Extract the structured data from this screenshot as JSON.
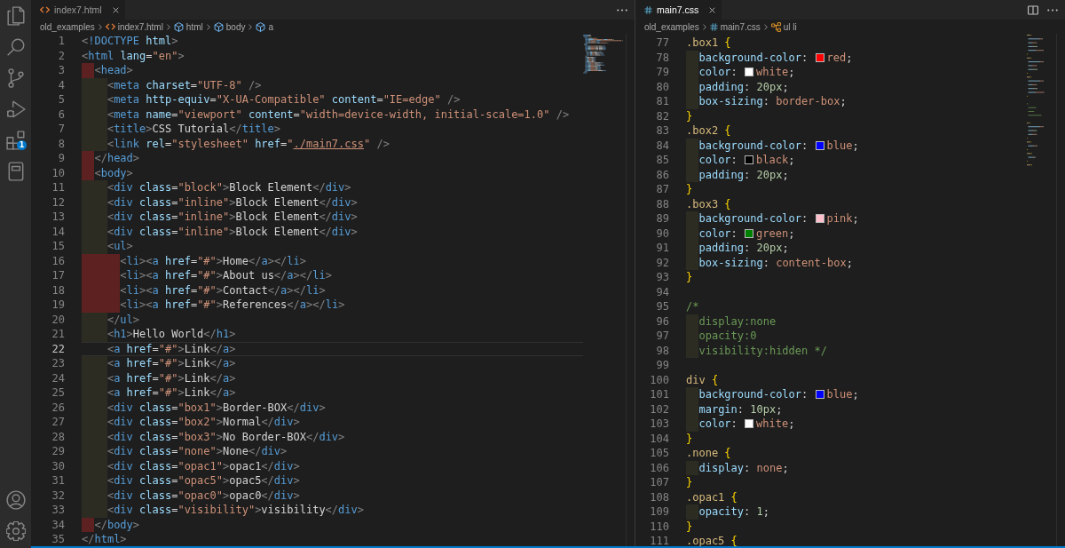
{
  "activity_bar": {
    "top": [
      {
        "kind": "files",
        "selected": false
      },
      {
        "kind": "search",
        "selected": false
      },
      {
        "kind": "branch",
        "selected": false
      },
      {
        "kind": "debug",
        "selected": false
      },
      {
        "kind": "extensions",
        "selected": false,
        "badge": "1"
      },
      {
        "kind": "notebook",
        "selected": false
      }
    ],
    "bottom": [
      {
        "kind": "account",
        "selected": false
      },
      {
        "kind": "gear",
        "selected": false
      }
    ]
  },
  "editor_groups": [
    {
      "focused": false,
      "kind": "html",
      "tabs": [
        {
          "label": "index7.html",
          "kind": "html",
          "selected": true
        }
      ],
      "actions": [
        {
          "kind": "more"
        }
      ],
      "breadcrumbs": [
        {
          "label": "old_examples",
          "kind": "folder"
        },
        {
          "label": "index7.html",
          "kind": "html"
        },
        {
          "label": "html",
          "kind": "element"
        },
        {
          "label": "body",
          "kind": "element"
        },
        {
          "label": "a",
          "kind": "element"
        }
      ],
      "lines": [
        {
          "number": "1",
          "code": "<!DOCTYPE html>",
          "current": false,
          "link": false
        },
        {
          "number": "2",
          "code": "<html lang=\"en\">",
          "current": false,
          "link": false
        },
        {
          "number": "3",
          "code": "  <head>",
          "current": false,
          "indent_error": true,
          "link": false
        },
        {
          "number": "4",
          "code": "    <meta charset=\"UTF-8\" />",
          "current": false,
          "indent_error": false,
          "link": false
        },
        {
          "number": "5",
          "code": "    <meta http-equiv=\"X-UA-Compatible\" content=\"IE=edge\" />",
          "current": false,
          "indent_error": false,
          "link": false
        },
        {
          "number": "6",
          "code": "    <meta name=\"viewport\" content=\"width=device-width, initial-scale=1.0\" />",
          "current": false,
          "indent_error": false,
          "link": false
        },
        {
          "number": "7",
          "code": "    <title>CSS Tutorial</title>",
          "current": false,
          "indent_error": false,
          "link": false
        },
        {
          "number": "8",
          "code": "    <link rel=\"stylesheet\" href=\"./main7.css\" />",
          "current": false,
          "indent_error": false,
          "link": true
        },
        {
          "number": "9",
          "code": "  </head>",
          "current": false,
          "indent_error": true,
          "link": false
        },
        {
          "number": "10",
          "code": "  <body>",
          "current": false,
          "indent_error": true,
          "link": false
        },
        {
          "number": "11",
          "code": "    <div class=\"block\">Block Element</div>",
          "current": false,
          "indent_error": false,
          "link": false
        },
        {
          "number": "12",
          "code": "    <div class=\"inline\">Block Element</div>",
          "current": false,
          "indent_error": false,
          "link": false
        },
        {
          "number": "13",
          "code": "    <div class=\"inline\">Block Element</div>",
          "current": false,
          "indent_error": false,
          "link": false
        },
        {
          "number": "14",
          "code": "    <div class=\"inline\">Block Element</div>",
          "current": false,
          "indent_error": false,
          "link": false
        },
        {
          "number": "15",
          "code": "    <ul>",
          "current": false,
          "indent_error": false,
          "link": false
        },
        {
          "number": "16",
          "code": "      <li><a href=\"#\">Home</a></li>",
          "current": false,
          "indent_error": true,
          "link": false
        },
        {
          "number": "17",
          "code": "      <li><a href=\"#\">About us</a></li>",
          "current": false,
          "indent_error": true,
          "link": false
        },
        {
          "number": "18",
          "code": "      <li><a href=\"#\">Contact</a></li>",
          "current": false,
          "indent_error": true,
          "link": false
        },
        {
          "number": "19",
          "code": "      <li><a href=\"#\">References</a></li>",
          "current": false,
          "indent_error": true,
          "link": false
        },
        {
          "number": "20",
          "code": "    </ul>",
          "current": false,
          "indent_error": false,
          "link": false
        },
        {
          "number": "21",
          "code": "    <h1>Hello World</h1>",
          "current": false,
          "indent_error": false,
          "link": false
        },
        {
          "number": "22",
          "code": "    <a href=\"#\">Link</a>",
          "current": true,
          "link": false
        },
        {
          "number": "23",
          "code": "    <a href=\"#\">Link</a>",
          "current": false,
          "indent_error": false,
          "link": false
        },
        {
          "number": "24",
          "code": "    <a href=\"#\">Link</a>",
          "current": false,
          "indent_error": false,
          "link": false
        },
        {
          "number": "25",
          "code": "    <a href=\"#\">Link</a>",
          "current": false,
          "indent_error": false,
          "link": false
        },
        {
          "number": "26",
          "code": "    <div class=\"box1\">Border-BOX</div>",
          "current": false,
          "indent_error": false,
          "link": false
        },
        {
          "number": "27",
          "code": "    <div class=\"box2\">Normal</div>",
          "current": false,
          "indent_error": false,
          "link": false
        },
        {
          "number": "28",
          "code": "    <div class=\"box3\">No Border-BOX</div>",
          "current": false,
          "indent_error": false,
          "link": false
        },
        {
          "number": "29",
          "code": "    <div class=\"none\">None</div>",
          "current": false,
          "indent_error": false,
          "link": false
        },
        {
          "number": "30",
          "code": "    <div class=\"opac1\">opac1</div>",
          "current": false,
          "indent_error": false,
          "link": false
        },
        {
          "number": "31",
          "code": "    <div class=\"opac5\">opac5</div>",
          "current": false,
          "indent_error": false,
          "link": false
        },
        {
          "number": "32",
          "code": "    <div class=\"opac0\">opac0</div>",
          "current": false,
          "indent_error": false,
          "link": false
        },
        {
          "number": "33",
          "code": "    <div class=\"visibility\">visibility</div>",
          "current": false,
          "indent_error": false,
          "link": false
        },
        {
          "number": "34",
          "code": "  </body>",
          "current": false,
          "indent_error": true,
          "link": false
        },
        {
          "number": "35",
          "code": "</html>",
          "current": false,
          "link": false
        }
      ]
    },
    {
      "focused": true,
      "kind": "css",
      "tabs": [
        {
          "label": "main7.css",
          "kind": "css",
          "selected": true
        }
      ],
      "actions": [
        {
          "kind": "split"
        },
        {
          "kind": "more"
        }
      ],
      "breadcrumbs": [
        {
          "label": "old_examples",
          "kind": "folder"
        },
        {
          "label": "main7.css",
          "kind": "css"
        },
        {
          "label": "ul li",
          "kind": "selector"
        }
      ],
      "lines": [
        {
          "number": "77",
          "code": ".box1 {",
          "current": false
        },
        {
          "number": "78",
          "code": "  background-color: red;",
          "current": false,
          "indent_error": false,
          "color": "#ff0000"
        },
        {
          "number": "79",
          "code": "  color: white;",
          "current": false,
          "indent_error": false,
          "color": "#ffffff"
        },
        {
          "number": "80",
          "code": "  padding: 20px;",
          "current": false,
          "indent_error": false
        },
        {
          "number": "81",
          "code": "  box-sizing: border-box;",
          "current": false,
          "indent_error": false
        },
        {
          "number": "82",
          "code": "}",
          "current": false
        },
        {
          "number": "83",
          "code": ".box2 {",
          "current": false
        },
        {
          "number": "84",
          "code": "  background-color: blue;",
          "current": false,
          "indent_error": false,
          "color": "#0000ff"
        },
        {
          "number": "85",
          "code": "  color: black;",
          "current": false,
          "indent_error": false,
          "color": "#000000"
        },
        {
          "number": "86",
          "code": "  padding: 20px;",
          "current": false,
          "indent_error": false
        },
        {
          "number": "87",
          "code": "}",
          "current": false
        },
        {
          "number": "88",
          "code": ".box3 {",
          "current": false
        },
        {
          "number": "89",
          "code": "  background-color: pink;",
          "current": false,
          "indent_error": false,
          "color": "#ffc0cb"
        },
        {
          "number": "90",
          "code": "  color: green;",
          "current": false,
          "indent_error": false,
          "color": "#008000"
        },
        {
          "number": "91",
          "code": "  padding: 20px;",
          "current": false,
          "indent_error": false
        },
        {
          "number": "92",
          "code": "  box-sizing: content-box;",
          "current": false,
          "indent_error": false
        },
        {
          "number": "93",
          "code": "}",
          "current": false
        },
        {
          "number": "94",
          "current": false
        },
        {
          "number": "95",
          "code": "/*",
          "current": false
        },
        {
          "number": "96",
          "code": "  display:none",
          "current": false,
          "indent_error": false
        },
        {
          "number": "97",
          "code": "  opacity:0",
          "current": false,
          "indent_error": false
        },
        {
          "number": "98",
          "code": "  visibility:hidden */",
          "current": false,
          "indent_error": false
        },
        {
          "number": "99",
          "current": false
        },
        {
          "number": "100",
          "code": "div {",
          "current": false
        },
        {
          "number": "101",
          "code": "  background-color: blue;",
          "current": false,
          "indent_error": false,
          "color": "#0000ff"
        },
        {
          "number": "102",
          "code": "  margin: 10px;",
          "current": false,
          "indent_error": false
        },
        {
          "number": "103",
          "code": "  color: white;",
          "current": false,
          "indent_error": false,
          "color": "#ffffff"
        },
        {
          "number": "104",
          "code": "}",
          "current": false
        },
        {
          "number": "105",
          "code": ".none {",
          "current": false
        },
        {
          "number": "106",
          "code": "  display: none;",
          "current": false,
          "indent_error": false
        },
        {
          "number": "107",
          "code": "}",
          "current": false
        },
        {
          "number": "108",
          "code": ".opac1 {",
          "current": false
        },
        {
          "number": "109",
          "code": "  opacity: 1;",
          "current": false,
          "indent_error": false
        },
        {
          "number": "110",
          "code": "}",
          "current": false
        },
        {
          "number": "111",
          "code": ".opac5 {",
          "current": false
        }
      ]
    }
  ]
}
